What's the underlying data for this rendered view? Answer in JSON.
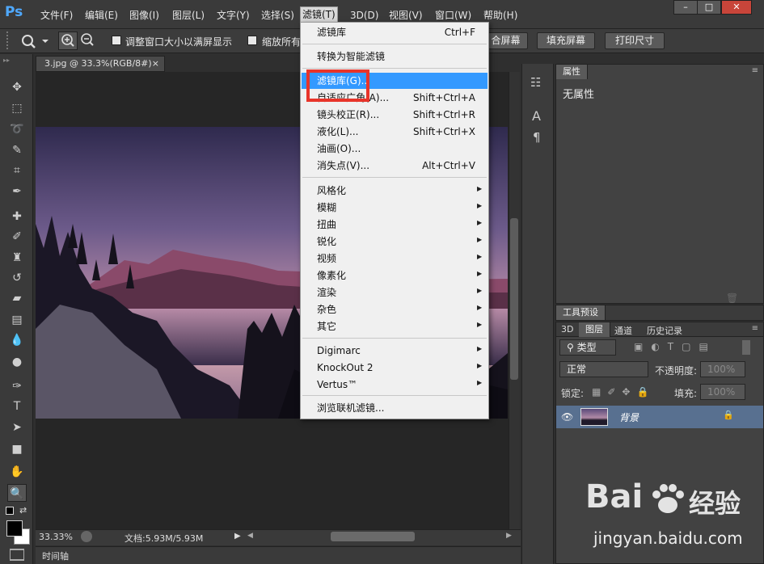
{
  "app": {
    "logo": "Ps"
  },
  "menubar": {
    "items": [
      "文件(F)",
      "编辑(E)",
      "图像(I)",
      "图层(L)",
      "文字(Y)",
      "选择(S)",
      "滤镜(T)",
      "3D(D)",
      "视图(V)",
      "窗口(W)",
      "帮助(H)"
    ],
    "active_index": 6
  },
  "window_controls": {
    "minimize": "–",
    "maximize": "□",
    "close": "✕"
  },
  "options_bar": {
    "resize_window_label": "调整窗口大小以满屏显示",
    "zoom_all_label": "缩放所有",
    "fit_screen_label": "合屏幕",
    "fill_screen_label": "填充屏幕",
    "print_size_label": "打印尺寸"
  },
  "document": {
    "tab_title": "3.jpg @ 33.3%(RGB/8#)",
    "tab_close": "×"
  },
  "status_bar": {
    "zoom": "33.33%",
    "doc_info": "文档:5.93M/5.93M"
  },
  "timeline": {
    "label": "时间轴"
  },
  "properties_panel": {
    "tab": "属性",
    "content": "无属性"
  },
  "tool_preset_panel": {
    "tab": "工具预设"
  },
  "layers_panel": {
    "tabs": [
      "3D",
      "图层",
      "通道",
      "历史记录"
    ],
    "active_tab": 1,
    "filter_kind": "类型",
    "blend_mode": "正常",
    "opacity_label": "不透明度:",
    "opacity_value": "100%",
    "lock_label": "锁定:",
    "fill_label": "填充:",
    "fill_value": "100%",
    "layer_name": "背景"
  },
  "filter_menu": {
    "groups": [
      [
        {
          "label": "滤镜库",
          "shortcut": "Ctrl+F"
        }
      ],
      [
        {
          "label": "转换为智能滤镜",
          "shortcut": ""
        }
      ],
      [
        {
          "label": "滤镜库(G)...",
          "shortcut": "",
          "highlighted": true
        },
        {
          "label": "自适应广角(A)...",
          "shortcut": "Shift+Ctrl+A"
        },
        {
          "label": "镜头校正(R)...",
          "shortcut": "Shift+Ctrl+R"
        },
        {
          "label": "液化(L)...",
          "shortcut": "Shift+Ctrl+X"
        },
        {
          "label": "油画(O)...",
          "shortcut": ""
        },
        {
          "label": "消失点(V)...",
          "shortcut": "Alt+Ctrl+V"
        }
      ],
      [
        {
          "label": "风格化",
          "submenu": true
        },
        {
          "label": "模糊",
          "submenu": true
        },
        {
          "label": "扭曲",
          "submenu": true
        },
        {
          "label": "锐化",
          "submenu": true
        },
        {
          "label": "视频",
          "submenu": true
        },
        {
          "label": "像素化",
          "submenu": true
        },
        {
          "label": "渲染",
          "submenu": true
        },
        {
          "label": "杂色",
          "submenu": true
        },
        {
          "label": "其它",
          "submenu": true
        }
      ],
      [
        {
          "label": "Digimarc",
          "submenu": true
        },
        {
          "label": "KnockOut 2",
          "submenu": true
        },
        {
          "label": "Vertus™",
          "submenu": true
        }
      ],
      [
        {
          "label": "浏览联机滤镜...",
          "shortcut": ""
        }
      ]
    ]
  },
  "watermark": {
    "brand": "Bai",
    "brand2": "经验",
    "url": "jingyan.baidu.com"
  },
  "colors": {
    "highlight": "#3399ff",
    "annotation_red": "#e8342a",
    "ps_blue": "#4fa9ff"
  }
}
